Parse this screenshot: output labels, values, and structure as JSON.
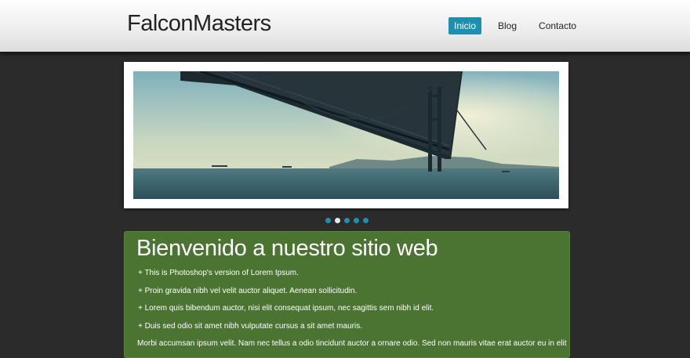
{
  "header": {
    "logo": "FalconMasters",
    "nav": [
      {
        "label": "Inicio",
        "active": true
      },
      {
        "label": "Blog",
        "active": false
      },
      {
        "label": "Contacto",
        "active": false
      }
    ]
  },
  "slider": {
    "dot_count": 5,
    "active_dot": 2
  },
  "welcome": {
    "title": "Bienvenido a nuestro sitio web",
    "items": [
      "+ This is Photoshop's version  of Lorem Ipsum.",
      "+ Proin gravida nibh vel velit auctor aliquet. Aenean sollicitudin.",
      "+ Lorem quis bibendum auctor, nisi elit consequat ipsum, nec sagittis sem nibh id elit.",
      "+ Duis sed odio sit amet nibh vulputate cursus a sit amet mauris."
    ],
    "paragraph": "Morbi accumsan ipsum velit. Nam nec tellus a odio tincidunt auctor a ornare odio. Sed non  mauris vitae erat auctor eu in elit"
  },
  "colors": {
    "accent": "#1f8fb0",
    "panel": "#4b7432",
    "background": "#2b2b2b"
  }
}
